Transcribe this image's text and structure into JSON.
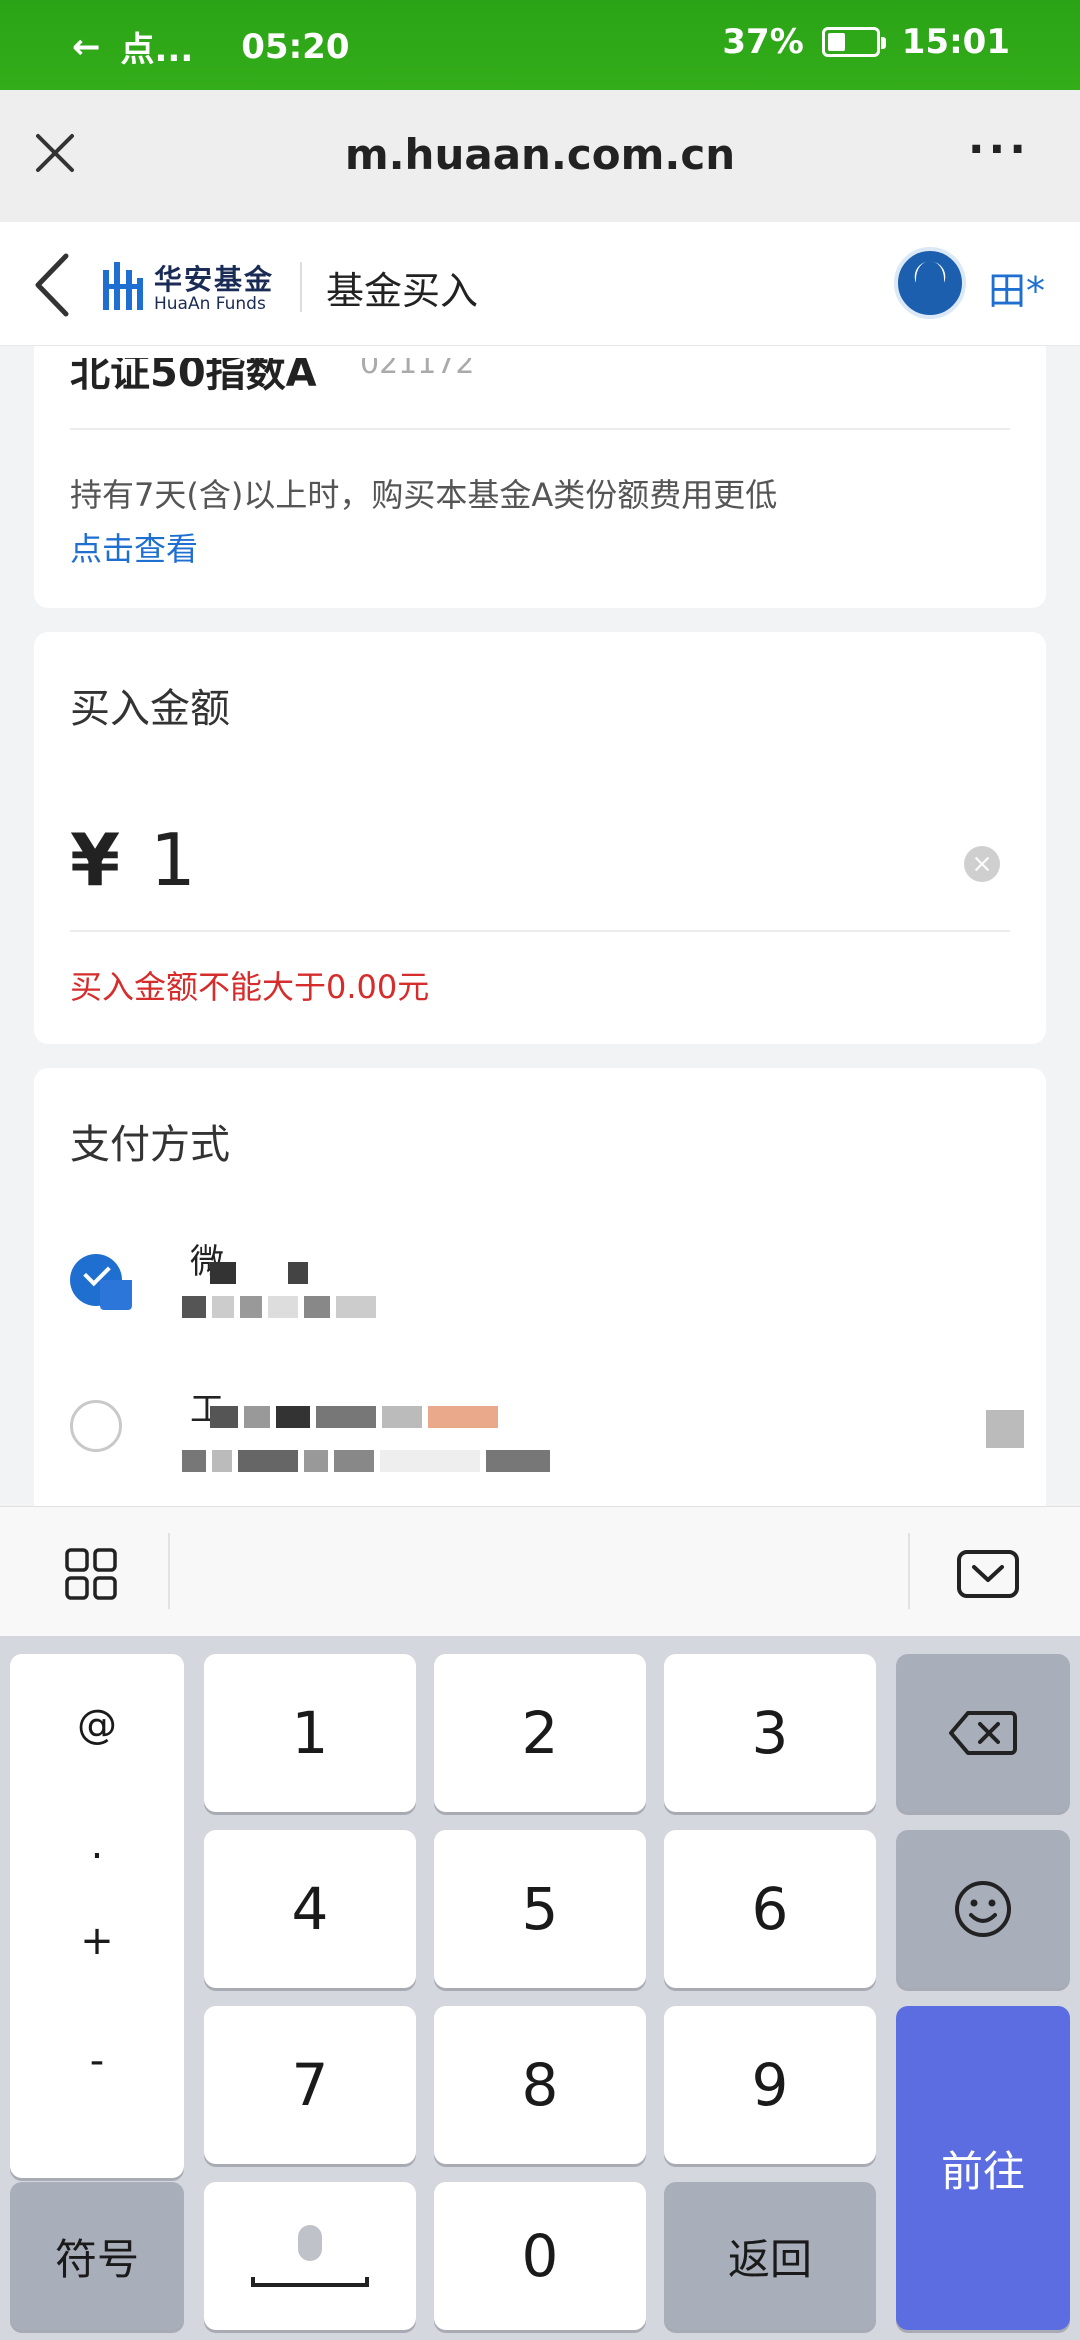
{
  "status_bar": {
    "back_arrow": "←",
    "app_label": "点...",
    "left_time": "05:20",
    "battery_percent": "37%",
    "battery_level": 0.37,
    "time": "15:01"
  },
  "browser": {
    "url": "m.huaan.com.cn",
    "more_label": "···"
  },
  "header": {
    "logo_cn": "华安基金",
    "logo_en": "HuaAn Funds",
    "title": "基金买入",
    "user_label": "田*"
  },
  "fund": {
    "name": "北证50指数A",
    "code": "021172",
    "note": "持有7天(含)以上时，购买本基金A类份额费用更低",
    "note_link": "点击查看"
  },
  "purchase": {
    "section_title": "买入金额",
    "currency": "¥",
    "amount": "1",
    "error": "买入金额不能大于0.00元"
  },
  "payment": {
    "section_title": "支付方式",
    "options": [
      {
        "name": "微",
        "selected": true
      },
      {
        "name": "工",
        "selected": false
      }
    ]
  },
  "keyboard": {
    "symbols": [
      "@",
      ".",
      "+",
      "-"
    ],
    "digits": [
      "1",
      "2",
      "3",
      "4",
      "5",
      "6",
      "7",
      "8",
      "9",
      "0"
    ],
    "symbol_key": "符号",
    "return_key": "返回",
    "go_key": "前往"
  },
  "colors": {
    "status_bar": "#2aa316",
    "link": "#1f6fd0",
    "error": "#d62c2c",
    "go_key": "#5b6de0"
  }
}
